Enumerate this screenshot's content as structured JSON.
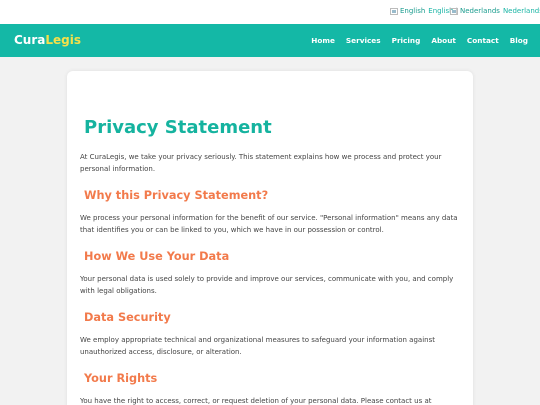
{
  "language_bar": {
    "english": {
      "alt": "English",
      "label": "English"
    },
    "separator": "|",
    "dutch": {
      "alt": "Nederlands",
      "label": "Nederlands"
    }
  },
  "navbar": {
    "logo_part1": "Cura",
    "logo_part2": "Legis",
    "links": [
      "Home",
      "Services",
      "Pricing",
      "About",
      "Contact",
      "Blog"
    ]
  },
  "content": {
    "title": "Privacy Statement",
    "intro": "At CuraLegis, we take your privacy seriously. This statement explains how we process and protect your personal information.",
    "sections": [
      {
        "heading": "Why this Privacy Statement?",
        "text": "We process your personal information for the benefit of our service. \"Personal information\" means any data that identifies you or can be linked to you, which we have in our possession or control."
      },
      {
        "heading": "How We Use Your Data",
        "text": "Your personal data is used solely to provide and improve our services, communicate with you, and comply with legal obligations."
      },
      {
        "heading": "Data Security",
        "text": "We employ appropriate technical and organizational measures to safeguard your information against unauthorized access, disclosure, or alteration."
      },
      {
        "heading": "Your Rights",
        "text": "You have the right to access, correct, or request deletion of your personal data. Please contact us at"
      }
    ]
  },
  "colors": {
    "brand_teal": "#14b8a6",
    "heading_orange": "#f27a4b",
    "logo_yellow": "#f5e04a"
  }
}
